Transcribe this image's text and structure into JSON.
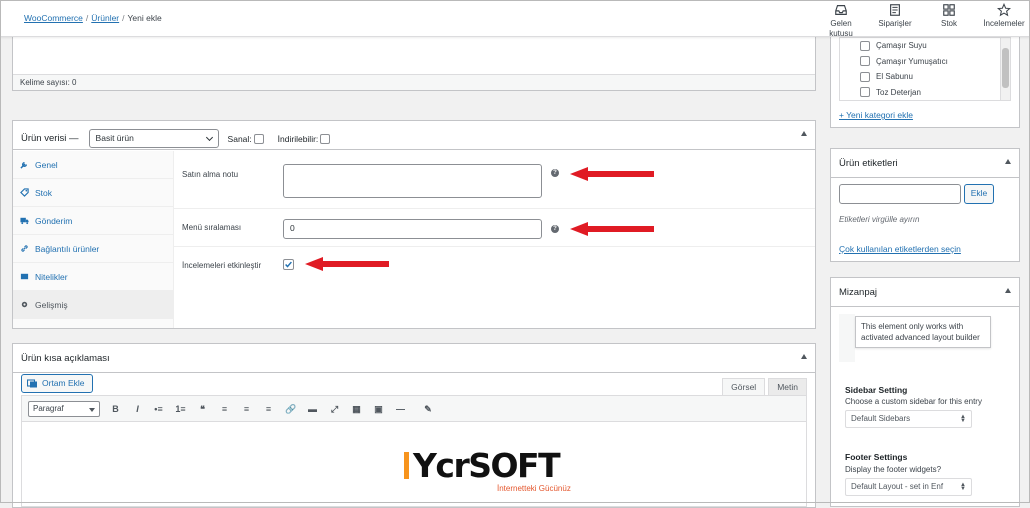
{
  "breadcrumb": {
    "link1": "WooCommerce",
    "link2": "Ürünler",
    "current": "Yeni ekle",
    "separator": "/"
  },
  "topnav": [
    {
      "label": "Gelen kutusu",
      "icon": "inbox-icon"
    },
    {
      "label": "Siparişler",
      "icon": "orders-icon"
    },
    {
      "label": "Stok",
      "icon": "stock-icon"
    },
    {
      "label": "İncelemeler",
      "icon": "star-icon"
    }
  ],
  "editor": {
    "word_count": "Kelime sayısı: 0"
  },
  "product_data": {
    "title": "Ürün verisi —",
    "type_selected": "Basit ürün",
    "virtual_label": "Sanal:",
    "downloadable_label": "İndirilebilir:",
    "tabs": [
      {
        "label": "Genel",
        "icon": "wrench-icon"
      },
      {
        "label": "Stok",
        "icon": "tag-icon"
      },
      {
        "label": "Gönderim",
        "icon": "truck-icon"
      },
      {
        "label": "Bağlantılı ürünler",
        "icon": "link-icon"
      },
      {
        "label": "Nitelikler",
        "icon": "list-icon"
      },
      {
        "label": "Gelişmiş",
        "icon": "gear-icon"
      }
    ],
    "purchase_note_label": "Satın alma notu",
    "purchase_note_value": "",
    "menu_order_label": "Menü sıralaması",
    "menu_order_value": "0",
    "reviews_label": "İncelemeleri etkinleştir",
    "reviews_enabled": true
  },
  "short_desc": {
    "title": "Ürün kısa açıklaması",
    "add_media": "Ortam Ekle",
    "tab_visual": "Görsel",
    "tab_text": "Metin",
    "format_selected": "Paragraf",
    "tools": [
      "B",
      "I",
      "•≡",
      "1≡",
      "❝",
      "≡",
      "≡",
      "≡",
      "🔗",
      "▬",
      "⤢",
      "▦",
      "▣",
      "—",
      "✎"
    ]
  },
  "categories": {
    "items": [
      "Çamaşır Suyu",
      "Çamaşır Yumuşatıcı",
      "El Sabunu",
      "Toz Deterjan"
    ],
    "add_link": "+ Yeni kategori ekle"
  },
  "tags": {
    "title": "Ürün etiketleri",
    "input_value": "",
    "add_button": "Ekle",
    "hint": "Etiketleri virgülle ayırın",
    "popular_link": "Çok kullanılan etiketlerden seçin"
  },
  "layout": {
    "title": "Mizanpaj",
    "notice": "This element only works with activated advanced layout builder",
    "sidebar_title": "Sidebar Setting",
    "sidebar_desc": "Choose a custom sidebar for this entry",
    "sidebar_value": "Default Sidebars",
    "footer_title": "Footer Settings",
    "footer_desc": "Display the footer widgets?",
    "footer_value": "Default Layout - set in Enf"
  },
  "logo": {
    "text": "YcrSOFT",
    "tagline": "İnternetteki Gücünüz"
  },
  "colors": {
    "link": "#2271b1",
    "arrow": "#e01b24",
    "logo_orange": "#f7941d",
    "logo_tag": "#e4572e"
  }
}
